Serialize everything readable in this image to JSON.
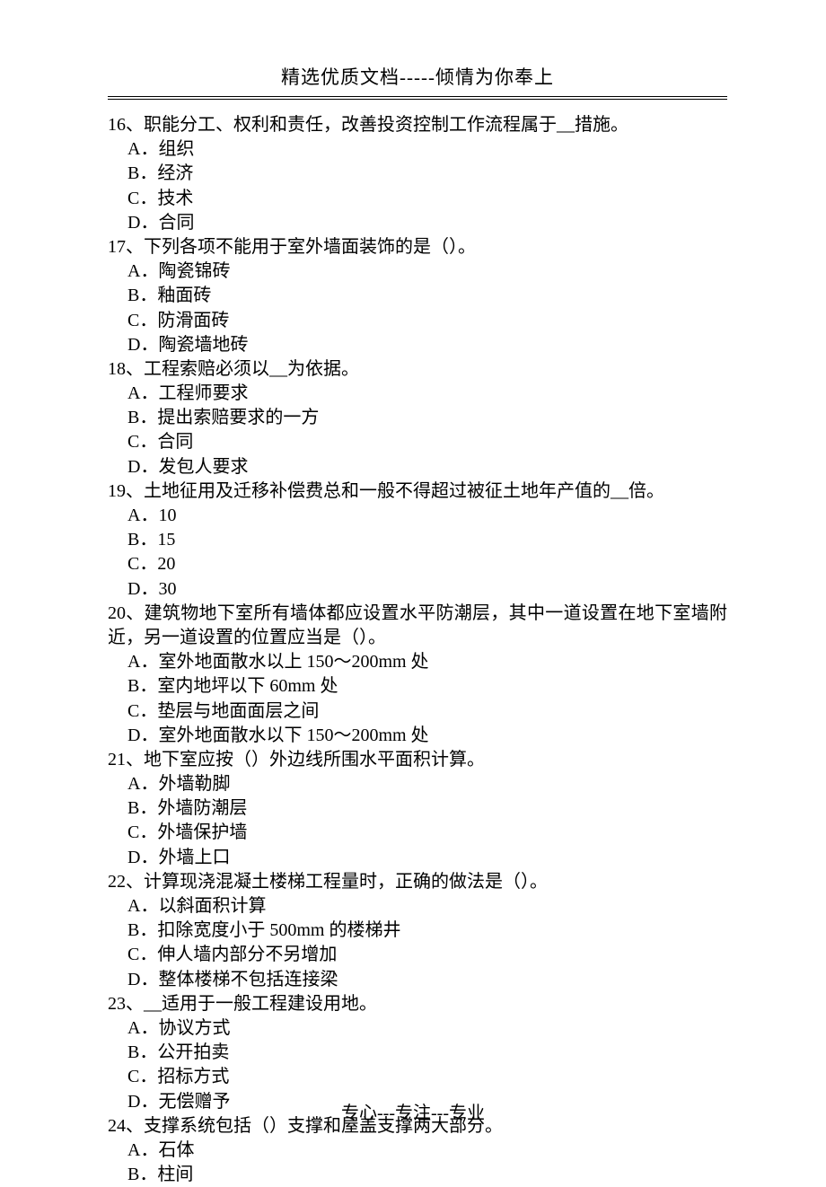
{
  "header": "精选优质文档-----倾情为你奉上",
  "footer": "专心---专注---专业",
  "questions": [
    {
      "num": "16",
      "stem": "职能分工、权利和责任，改善投资控制工作流程属于__措施。",
      "opts": [
        "组织",
        "经济",
        "技术",
        "合同"
      ]
    },
    {
      "num": "17",
      "stem": "下列各项不能用于室外墙面装饰的是（）。",
      "opts": [
        "陶瓷锦砖",
        "釉面砖",
        "防滑面砖",
        "陶瓷墙地砖"
      ]
    },
    {
      "num": "18",
      "stem": "工程索赔必须以__为依据。",
      "opts": [
        "工程师要求",
        "提出索赔要求的一方",
        "合同",
        "发包人要求"
      ]
    },
    {
      "num": "19",
      "stem": "土地征用及迁移补偿费总和一般不得超过被征土地年产值的__倍。",
      "opts": [
        "10",
        "15",
        "20",
        "30"
      ]
    },
    {
      "num": "20",
      "stem": "建筑物地下室所有墙体都应设置水平防潮层，其中一道设置在地下室墙附近，另一道设置的位置应当是（）。",
      "opts": [
        "室外地面散水以上 150～200mm 处",
        "室内地坪以下 60mm 处",
        "垫层与地面面层之间",
        "室外地面散水以下 150～200mm 处"
      ]
    },
    {
      "num": "21",
      "stem": "地下室应按（）外边线所围水平面积计算。",
      "opts": [
        "外墙勒脚",
        "外墙防潮层",
        "外墙保护墙",
        "外墙上口"
      ]
    },
    {
      "num": "22",
      "stem": "计算现浇混凝土楼梯工程量时，正确的做法是（）。",
      "opts": [
        "以斜面积计算",
        "扣除宽度小于 500mm 的楼梯井",
        "伸人墙内部分不另增加",
        "整体楼梯不包括连接梁"
      ]
    },
    {
      "num": "23",
      "stem": "__适用于一般工程建设用地。",
      "opts": [
        "协议方式",
        "公开拍卖",
        "招标方式",
        "无偿赠予"
      ]
    },
    {
      "num": "24",
      "stem": "支撑系统包括（）支撑和屋盖支撑两大部分。",
      "opts": [
        "石体",
        "柱间"
      ]
    }
  ],
  "optLetters": [
    "A",
    "B",
    "C",
    "D"
  ]
}
